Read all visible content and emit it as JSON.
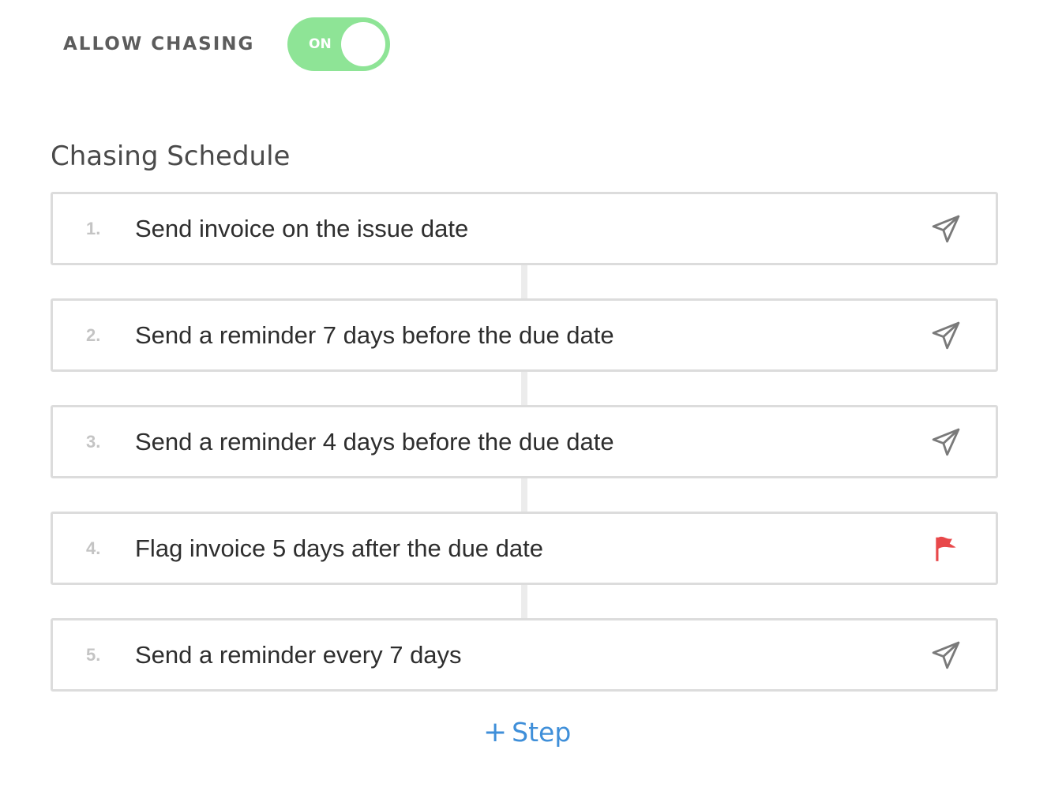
{
  "allow_chasing": {
    "label": "ALLOW CHASING",
    "toggle_text": "ON",
    "enabled": true,
    "toggle_color": "#8ee496"
  },
  "schedule": {
    "title": "Chasing Schedule",
    "steps": [
      {
        "number": "1.",
        "text": "Send invoice on the issue date",
        "icon": "paper-plane-icon"
      },
      {
        "number": "2.",
        "text": "Send a reminder 7 days before the due date",
        "icon": "paper-plane-icon"
      },
      {
        "number": "3.",
        "text": "Send a reminder 4 days before the due date",
        "icon": "paper-plane-icon"
      },
      {
        "number": "4.",
        "text": "Flag invoice 5 days after the due date",
        "icon": "flag-icon"
      },
      {
        "number": "5.",
        "text": "Send a reminder every 7 days",
        "icon": "paper-plane-icon"
      }
    ],
    "add_step_label": "Step",
    "add_step_icon": "plus-icon"
  },
  "colors": {
    "accent_blue": "#3f8fd9",
    "flag_red": "#e8484a",
    "plane_gray": "#7a7a7a"
  }
}
